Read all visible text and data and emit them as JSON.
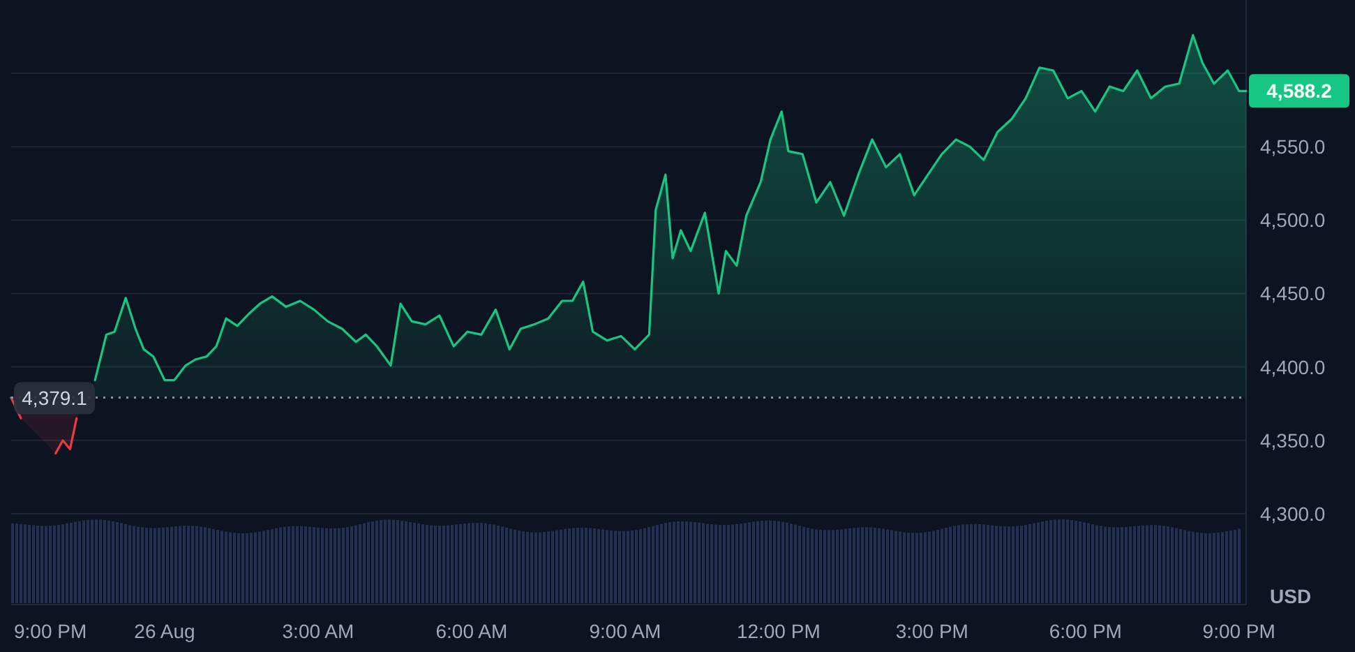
{
  "chart": {
    "current_price": {
      "text": "4,588.2"
    },
    "currency": "USD",
    "start_time_label": "9:00 PM",
    "chart_data": {
      "type": "area",
      "grid": true,
      "ref_lines": [
        {
          "axis": "y",
          "value": 4379.1,
          "label": "4,379.1"
        }
      ],
      "xlim": [
        -3,
        21.14
      ],
      "ylim": [
        4240,
        4650
      ],
      "xticks": [
        {
          "value": 0,
          "label": "26 Aug"
        },
        {
          "value": 3,
          "label": "3:00 AM"
        },
        {
          "value": 6,
          "label": "6:00 AM"
        },
        {
          "value": 9,
          "label": "9:00 AM"
        },
        {
          "value": 12,
          "label": "12:00 PM"
        },
        {
          "value": 15,
          "label": "3:00 PM"
        },
        {
          "value": 18,
          "label": "6:00 PM"
        },
        {
          "value": 21,
          "label": "9:00 PM"
        }
      ],
      "yticks": [
        {
          "value": 4300,
          "label": "4,300.0"
        },
        {
          "value": 4350,
          "label": "4,350.0"
        },
        {
          "value": 4400,
          "label": "4,400.0"
        },
        {
          "value": 4450,
          "label": "4,450.0"
        },
        {
          "value": 4500,
          "label": "4,500.0"
        },
        {
          "value": 4550,
          "label": "4,550.0"
        }
      ],
      "x": [
        -3,
        -2.81,
        -2.62,
        -2.4,
        -2.26,
        -2.13,
        -1.99,
        -1.85,
        -1.72,
        -1.53,
        -1.36,
        -1.14,
        -0.98,
        -0.76,
        -0.57,
        -0.41,
        -0.22,
        0,
        0.19,
        0.41,
        0.6,
        0.82,
        1.01,
        1.2,
        1.42,
        1.64,
        1.86,
        2.1,
        2.37,
        2.65,
        2.92,
        3.19,
        3.47,
        3.74,
        3.93,
        4.15,
        4.42,
        4.61,
        4.83,
        5.1,
        5.37,
        5.65,
        5.92,
        6.19,
        6.47,
        6.74,
        6.96,
        7.23,
        7.5,
        7.77,
        7.97,
        8.18,
        8.37,
        8.65,
        8.92,
        9.19,
        9.47,
        9.6,
        9.79,
        9.93,
        10.09,
        10.28,
        10.56,
        10.83,
        10.97,
        11.18,
        11.37,
        11.65,
        11.84,
        12.06,
        12.19,
        12.47,
        12.74,
        13.01,
        13.28,
        13.56,
        13.83,
        14.1,
        14.37,
        14.65,
        14.92,
        15.19,
        15.47,
        15.74,
        16.01,
        16.28,
        16.56,
        16.83,
        17.1,
        17.37,
        17.65,
        17.92,
        18.19,
        18.47,
        18.74,
        19.01,
        19.28,
        19.56,
        19.83,
        20.1,
        20.29,
        20.51,
        20.78,
        21.0,
        21.14
      ],
      "series": [
        {
          "color": "#16c784",
          "values": [
            4379,
            4365,
            null,
            null,
            null,
            4341,
            4350,
            4344,
            4365,
            null,
            4391,
            4422,
            4424,
            4447,
            4426,
            4412,
            4407,
            4391,
            4391,
            4401,
            4405,
            4407,
            4414,
            4433,
            4428,
            4436,
            4443,
            4448,
            4441,
            4445,
            4439,
            4431,
            4426,
            4417,
            4422,
            4414,
            4401,
            4443,
            4431,
            4429,
            4435,
            4414,
            4424,
            4422,
            4439,
            4412,
            4426,
            4429,
            4433,
            4445,
            4445,
            4458,
            4424,
            4418,
            4421,
            4412,
            4422,
            4507,
            4531,
            4474,
            4493,
            4479,
            4505,
            4450,
            4479,
            4469,
            4503,
            4526,
            4555,
            4574,
            4547,
            4545,
            4512,
            4526,
            4503,
            4531,
            4555,
            4536,
            4545,
            4517,
            4531,
            4545,
            4555,
            4550,
            4541,
            4560,
            4569,
            4583,
            4604,
            4602,
            4583,
            4588,
            4574,
            4591,
            4588,
            4602,
            4583,
            4591,
            4593,
            4626,
            4607,
            4593,
            4602,
            4588,
            4588
          ]
        }
      ]
    }
  }
}
